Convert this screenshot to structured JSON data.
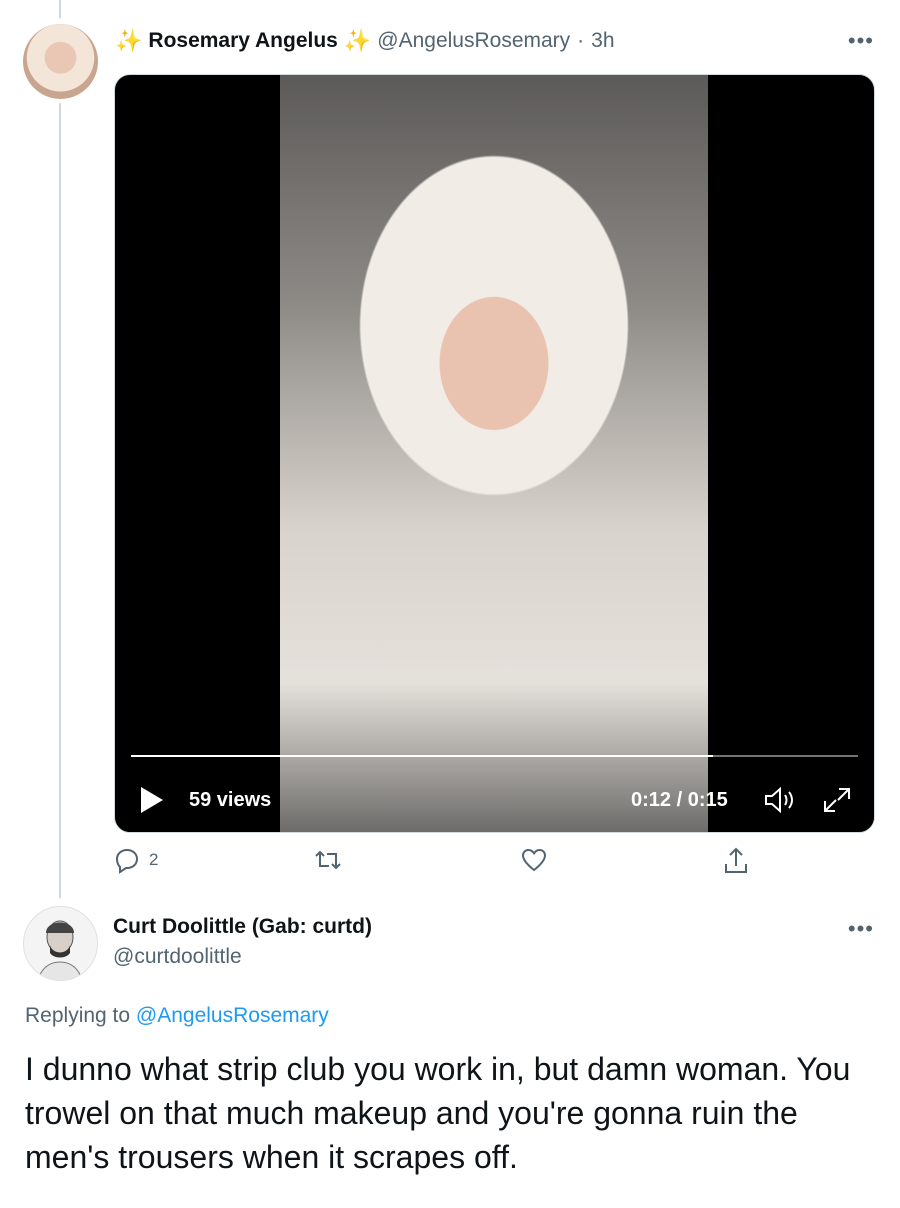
{
  "tweet": {
    "author_name": "Rosemary Angelus",
    "author_emoji": "✨",
    "author_handle": "@AngelusRosemary",
    "separator": "·",
    "time": "3h",
    "more_label": "•••",
    "video": {
      "views": "59 views",
      "time_display": "0:12 / 0:15",
      "progress": 0.8
    },
    "actions": {
      "reply_count": "2",
      "retweet_count": "",
      "like_count": ""
    }
  },
  "reply": {
    "author_name": "Curt Doolittle (Gab: curtd)",
    "author_handle": "@curtdoolittle",
    "more_label": "•••",
    "replying_prefix": "Replying to",
    "replying_to": "@AngelusRosemary",
    "text": "I dunno what strip club you work in, but damn woman. You trowel on that much makeup and you're gonna ruin the men's trousers when it scrapes off."
  },
  "colors": {
    "accent": "#1d9bf0",
    "muted": "#536471",
    "sparkle": "#f7c52b"
  }
}
